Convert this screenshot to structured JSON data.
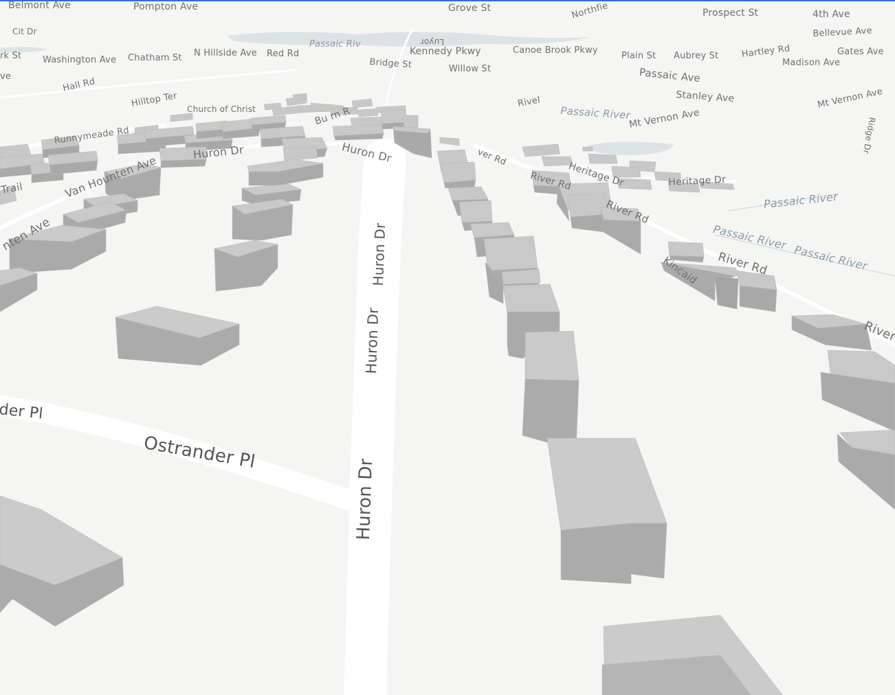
{
  "map": {
    "style": "3d-buildings-light",
    "colors": {
      "background": "#f5f5f4",
      "road": "#ffffff",
      "water": "#d7dde0",
      "building_top": "#c9c9c9",
      "building_side": "#a9a9a9"
    },
    "labels": {
      "belmont_ave": "Belmont Ave",
      "pompton_ave": "Pompton Ave",
      "grove_st": "Grove St",
      "northfield": "Northfie",
      "prospect_st": "Prospect St",
      "fourth_ave": "4th Ave",
      "cit_dr": "Cit Dr",
      "bellevue_ave": "Bellevue Ave",
      "rk_st": "rk St",
      "washington_ave": "Washington Ave",
      "chatham_st": "Chatham St",
      "n_hillside_ave": "N Hillside Ave",
      "red_rd": "Red Rd",
      "passaic_riv": "Passaic Riv",
      "luyor": "Luyor",
      "kennedy_pkwy": "Kennedy Pkwy",
      "canoe_brook_pkwy": "Canoe Brook Pkwy",
      "plain_st": "Plain St",
      "aubrey_st": "Aubrey St",
      "hartley_rd": "Hartley Rd",
      "gates_ave": "Gates Ave",
      "madison_ave": "Madison Ave",
      "ve": "ve",
      "bridge_st": "Bridge St",
      "willow_st": "Willow St",
      "passaic_ave": "Passaic Ave",
      "hall_rd": "Hall Rd",
      "stanley_ave": "Stanley Ave",
      "mt_vernon_ave_right": "Mt Vernon Ave",
      "hilltop_ter": "Hilltop Ter",
      "church_of_christ": "Church of Christ",
      "river_top": "Rivel",
      "passaic_river_1": "Passaic River",
      "mt_vernon_ave_mid": "Mt Vernon Ave",
      "burn_r": "Bu rn R",
      "runnymeade_rd": "Runnymeade Rd",
      "huron_dr_far": "Huron Dr",
      "huron_dr_left": "Huron Dr",
      "river_rd_far": "ver Rd",
      "heritage_dr_1": "Heritage Dr",
      "heritage_dr_2": "Heritage Dr",
      "van_hounten_ave_1": "Van Hounten Ave",
      "river_rd_2": "River Rd",
      "passaic_river_2": "Passaic River",
      "trail": "Trail",
      "river_rd_3": "River Rd",
      "hounten_ave": "nten Ave",
      "passaic_river_3": "Passaic River",
      "passaic_river_4": "Passaic River",
      "river_rd_4": "River Rd",
      "kincaid": "Kincaid",
      "huron_dr_v1": "Huron Dr",
      "huron_dr_v2": "Huron Dr",
      "river_right": "River",
      "der_pl": "der Pl",
      "ostrander_pl": "Ostrander Pl",
      "huron_dr_v3": "Huron Dr",
      "ridge_dr": "Ridge Dr"
    }
  }
}
